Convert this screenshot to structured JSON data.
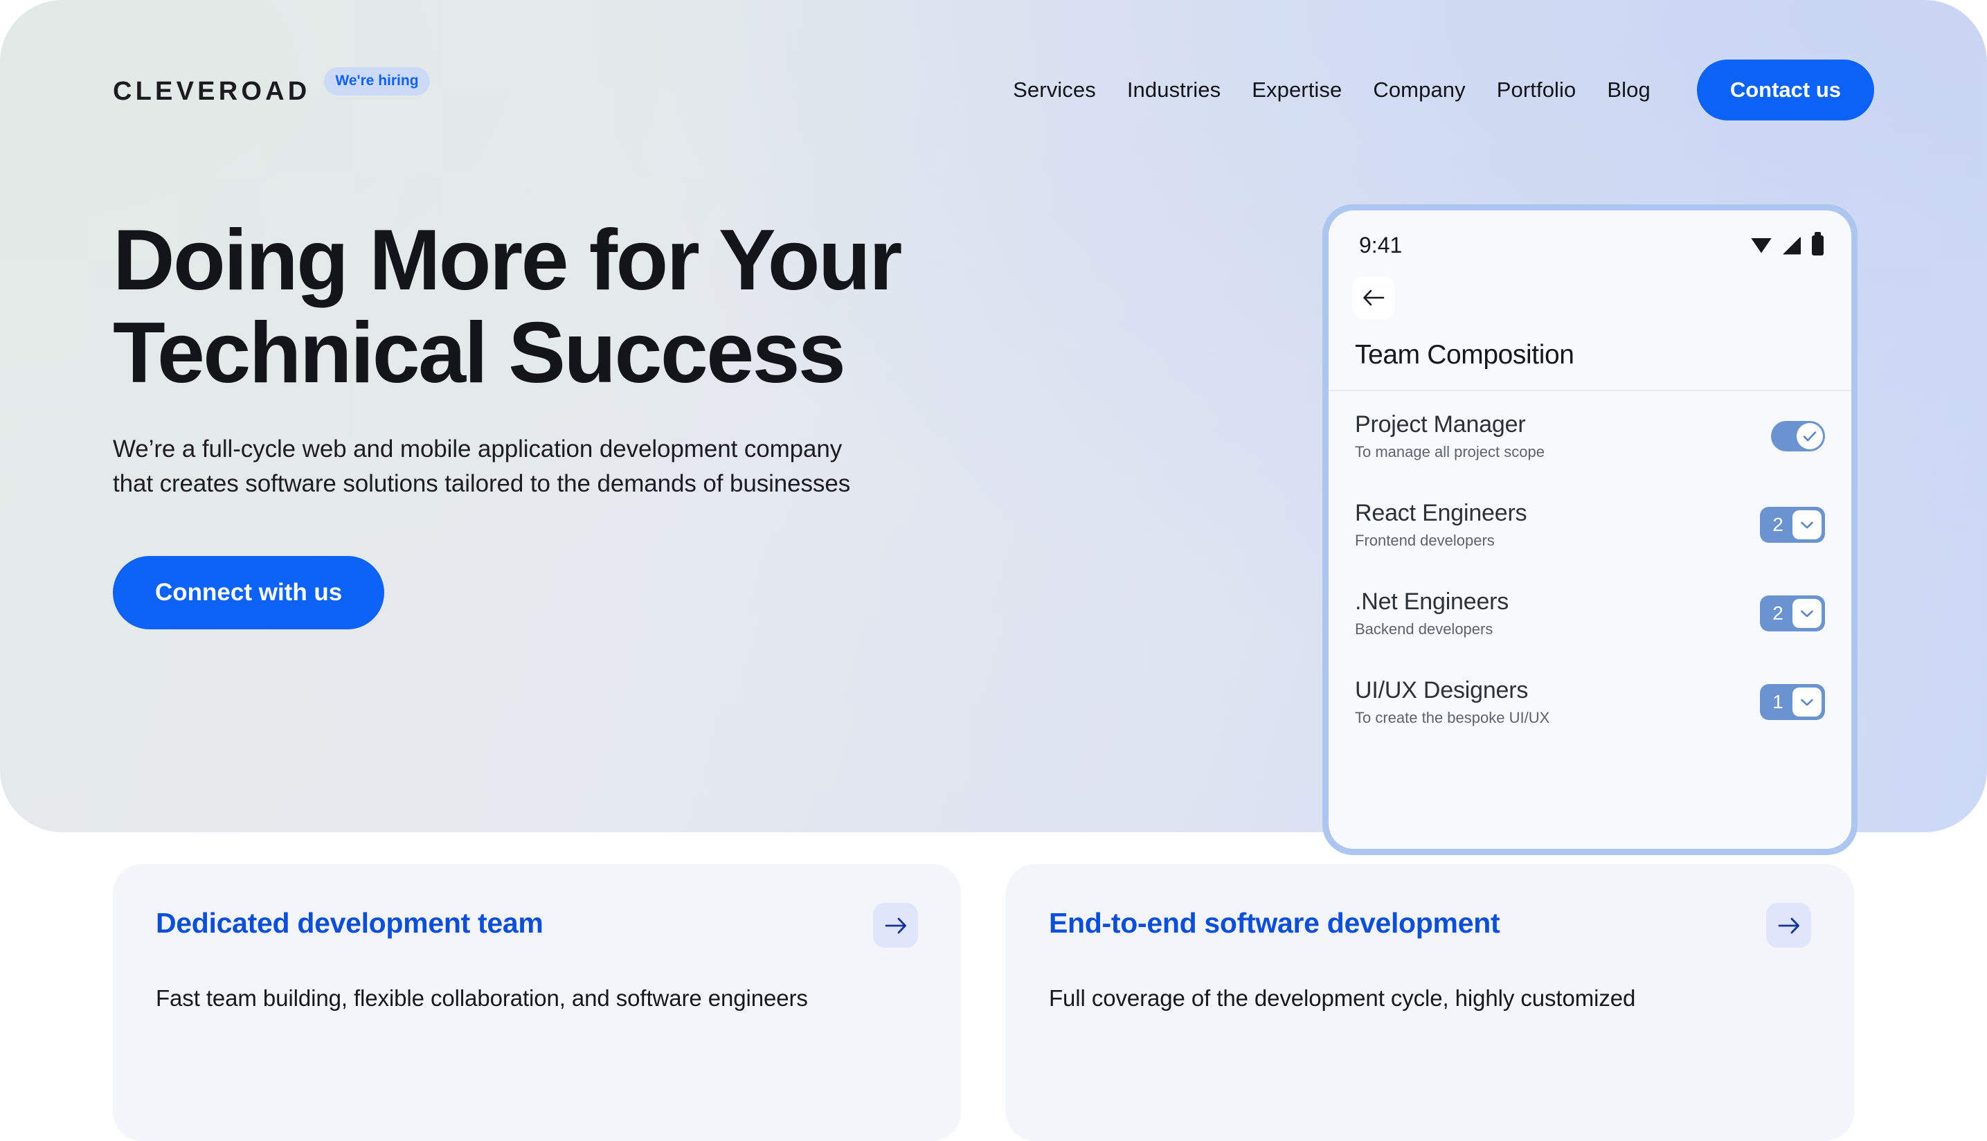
{
  "header": {
    "logo": "CLEVEROAD",
    "hiring_badge": "We're hiring",
    "nav": [
      {
        "label": "Services"
      },
      {
        "label": "Industries"
      },
      {
        "label": "Expertise"
      },
      {
        "label": "Company"
      },
      {
        "label": "Portfolio"
      },
      {
        "label": "Blog"
      }
    ],
    "contact_button": "Contact us"
  },
  "hero": {
    "headline_line1": "Doing More for Your",
    "headline_line2": "Technical Success",
    "subhead_line1": "We’re a full-cycle web and mobile application development company",
    "subhead_line2": "that creates software solutions tailored to the demands of businesses",
    "cta_button": "Connect with us"
  },
  "phone": {
    "status_time": "9:41",
    "status_icons": [
      "wifi-icon",
      "signal-icon",
      "battery-icon"
    ],
    "back_icon": "arrow-left-icon",
    "screen_title": "Team Composition",
    "team_rows": [
      {
        "title": "Project Manager",
        "subtitle": "To manage all project scope",
        "control": "toggle",
        "state": "on",
        "value": ""
      },
      {
        "title": "React Engineers",
        "subtitle": "Frontend developers",
        "control": "stepper",
        "state": "",
        "value": "2"
      },
      {
        "title": ".Net Engineers",
        "subtitle": "Backend developers",
        "control": "stepper",
        "state": "",
        "value": "2"
      },
      {
        "title": "UI/UX Designers",
        "subtitle": "To create the bespoke UI/UX",
        "control": "stepper",
        "state": "",
        "value": "1"
      }
    ]
  },
  "cards": [
    {
      "title": "Dedicated development team",
      "description": "Fast team building, flexible collaboration, and software engineers",
      "arrow_icon": "arrow-right-icon"
    },
    {
      "title": "End-to-end software development",
      "description": "Full coverage of the development cycle, highly customized",
      "arrow_icon": "arrow-right-icon"
    }
  ],
  "colors": {
    "accent_blue": "#0b62f5",
    "card_title_blue": "#0b4fd6",
    "phone_frame": "#adc6ef",
    "control_blue": "#6b93cf",
    "card_bg": "#f4f5fa",
    "arrow_chip": "#dfe5fa"
  }
}
